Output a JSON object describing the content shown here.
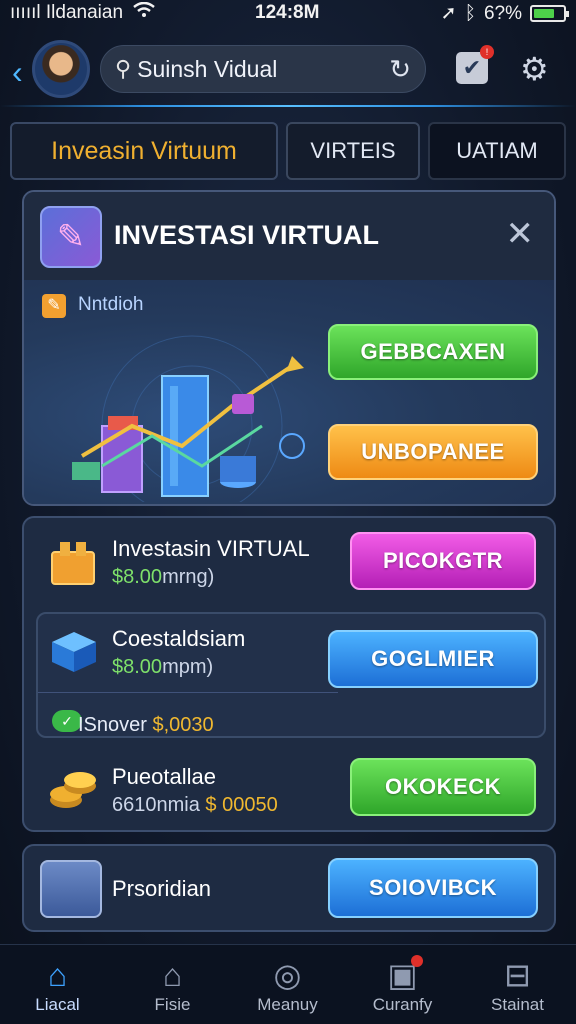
{
  "status_bar": {
    "carrier": "ıııııl Ildanaian",
    "time": "124:8M",
    "battery": "6?%",
    "battery_level": 0.7
  },
  "header": {
    "search_text": "Suinsh Vidual",
    "search_icon": "search-icon",
    "refresh_icon": "refresh-icon",
    "settings_icon": "gear-icon"
  },
  "tabs": [
    {
      "label": "Inveasin Virtuum"
    },
    {
      "label": "VIRTEIS"
    },
    {
      "label": "UATIAM"
    }
  ],
  "panel": {
    "title": "INVESTASI VIRTUAL",
    "nlabel": "Nntdioh",
    "btn_primary": "GEBBCAXEN",
    "btn_secondary": "UNBOPANEE"
  },
  "list": {
    "row1": {
      "title": "Investasin VIRTUAL",
      "sub_value": "$8.00",
      "sub_unit": "mrng)",
      "button": "PICOKGTR"
    },
    "row2": {
      "title": "Coestaldsiam",
      "sub_value": "$8.00",
      "sub_unit": "mpm)",
      "button": "GOGLMIER",
      "iss_label": "ISnover",
      "iss_amount": "$,0030"
    },
    "row3": {
      "title": "Pueotallae",
      "sub_value": "6610nmia",
      "sub_amount": "$ 00050",
      "button": "OKOKECK"
    }
  },
  "pro": {
    "label": "Prsoridian",
    "button": "SOIOVIBCK"
  },
  "bottom_nav": [
    {
      "label": "Liacal",
      "icon": "home-icon"
    },
    {
      "label": "Fisie",
      "icon": "house-outline-icon"
    },
    {
      "label": "Meanuy",
      "icon": "compass-icon"
    },
    {
      "label": "Curanfy",
      "icon": "briefcase-icon"
    },
    {
      "label": "Stainat",
      "icon": "store-icon"
    }
  ],
  "colors": {
    "accent": "#3ea2ff",
    "tab_active_text": "#f0b030",
    "green_button": "#3fb83a",
    "orange_button": "#f29a20",
    "magenta_button": "#d33ad0",
    "blue_button": "#2a86e8"
  }
}
